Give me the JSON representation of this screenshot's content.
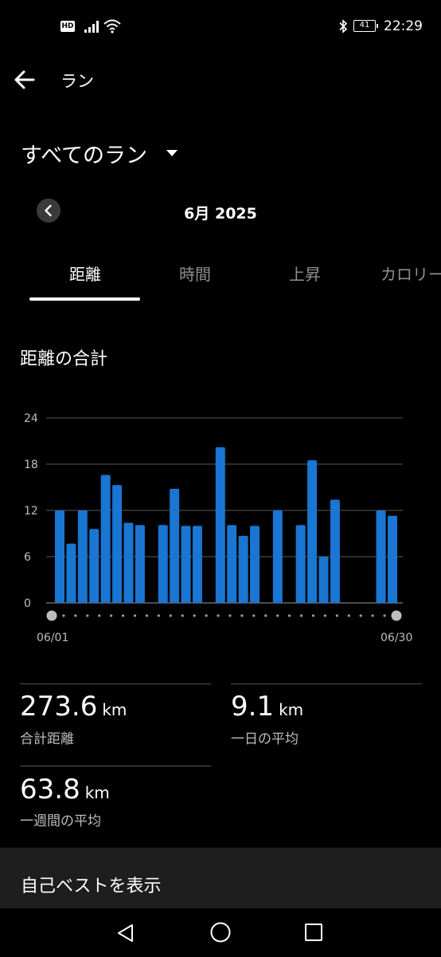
{
  "status": {
    "hd": "HD",
    "battery": "41",
    "time": "22:29"
  },
  "header": {
    "title": "ラン"
  },
  "filter": {
    "label": "すべてのラン"
  },
  "month": {
    "label": "6月 2025"
  },
  "tabs": [
    {
      "label": "距離",
      "active": true
    },
    {
      "label": "時間",
      "active": false
    },
    {
      "label": "上昇",
      "active": false
    },
    {
      "label": "カロリー",
      "active": false
    }
  ],
  "chart": {
    "title": "距離の合計"
  },
  "chart_data": {
    "type": "bar",
    "ylim": [
      0,
      24
    ],
    "yticks": [
      "0",
      "6",
      "12",
      "18",
      "24"
    ],
    "x_start_label": "06/01",
    "x_end_label": "06/30",
    "days": 30,
    "values": [
      12,
      7.7,
      12,
      9.6,
      16.6,
      15.3,
      10.4,
      10.1,
      0,
      10.1,
      14.8,
      10,
      10,
      0,
      20.2,
      10.1,
      8.7,
      10,
      0,
      12,
      0,
      10.1,
      18.5,
      6,
      13.4,
      0,
      0,
      0,
      12,
      11.3
    ],
    "bar_color": "#1976d2",
    "grid": true
  },
  "stats": {
    "total": {
      "value": "273.6",
      "unit": "km",
      "label": "合計距離"
    },
    "daily_avg": {
      "value": "9.1",
      "unit": "km",
      "label": "一日の平均"
    },
    "weekly_avg": {
      "value": "63.8",
      "unit": "km",
      "label": "一週間の平均"
    }
  },
  "best": {
    "label": "自己ベストを表示"
  }
}
